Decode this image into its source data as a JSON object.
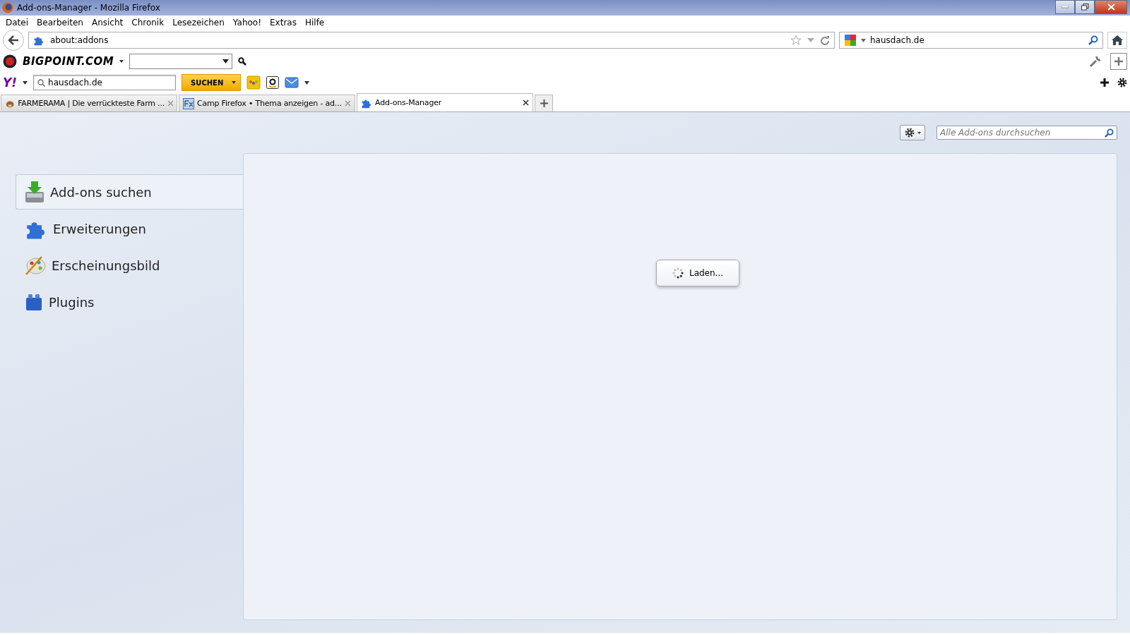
{
  "window": {
    "title": "Add-ons-Manager - Mozilla Firefox"
  },
  "menu_bar": [
    "Datei",
    "Bearbeiten",
    "Ansicht",
    "Chronik",
    "Lesezeichen",
    "Yahoo!",
    "Extras",
    "Hilfe"
  ],
  "address_bar": {
    "value": "about:addons"
  },
  "search_bar": {
    "value": "hausdach.de"
  },
  "bigpoint_toolbar": {
    "logo": "BIGPOINT.COM"
  },
  "yahoo_toolbar": {
    "logo": "Y!",
    "search_value": "hausdach.de",
    "search_button": "SUCHEN"
  },
  "tabs": [
    {
      "label": "FARMERAMA | Die verrückteste Farm ...",
      "selected": false,
      "kind": "farm"
    },
    {
      "label": "Camp Firefox • Thema anzeigen - ad...",
      "selected": false,
      "kind": "fx"
    },
    {
      "label": "Add-ons-Manager",
      "selected": true,
      "kind": "addons"
    }
  ],
  "addons": {
    "search": {
      "placeholder": "Alle Add-ons durchsuchen"
    },
    "categories": [
      {
        "label": "Add-ons suchen",
        "selected": true,
        "kind": "get"
      },
      {
        "label": "Erweiterungen",
        "selected": false,
        "kind": "extensions"
      },
      {
        "label": "Erscheinungsbild",
        "selected": false,
        "kind": "appearance"
      },
      {
        "label": "Plugins",
        "selected": false,
        "kind": "plugins"
      }
    ],
    "loading": "Laden..."
  }
}
